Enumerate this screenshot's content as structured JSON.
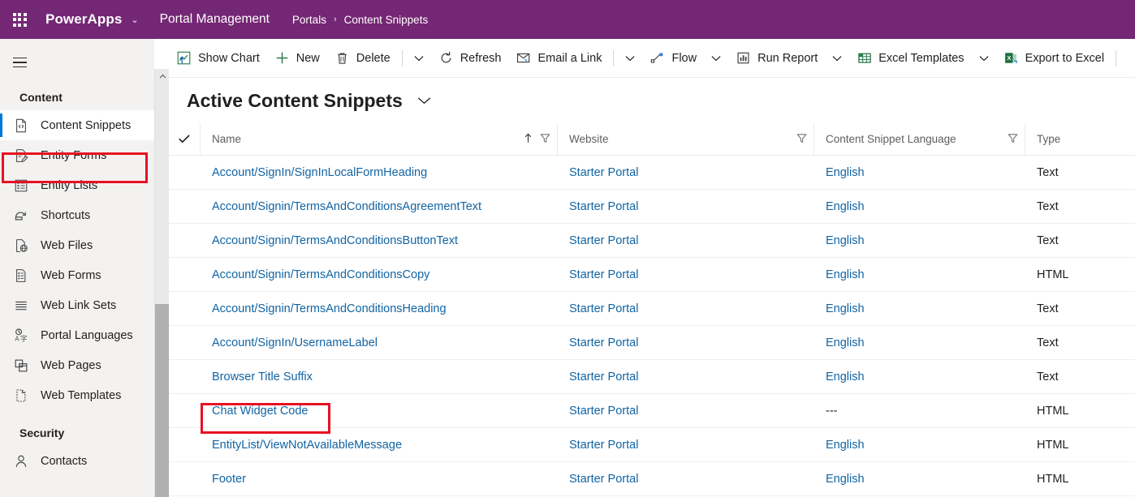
{
  "topbar": {
    "waffle_icon": "app-launcher-icon",
    "brand": "PowerApps",
    "brand_caret": "⌄",
    "app_name": "Portal Management",
    "breadcrumb": {
      "root": "Portals",
      "separator": "›",
      "current": "Content Snippets"
    },
    "background_color": "#742774"
  },
  "commandbar": {
    "items": [
      {
        "label": "Show Chart",
        "icon": "show-chart-icon",
        "caret": false
      },
      {
        "label": "New",
        "icon": "plus-icon",
        "caret": false
      },
      {
        "label": "Delete",
        "icon": "trash-icon",
        "caret": false
      },
      {
        "label": "",
        "icon": "overflow-caret-icon",
        "caret": true
      },
      {
        "label": "Refresh",
        "icon": "refresh-icon",
        "caret": false
      },
      {
        "label": "Email a Link",
        "icon": "email-link-icon",
        "caret": false
      },
      {
        "label": "",
        "icon": "overflow-caret-icon",
        "caret": true
      },
      {
        "label": "Flow",
        "icon": "flow-icon",
        "caret": true
      },
      {
        "label": "Run Report",
        "icon": "run-report-icon",
        "caret": true
      },
      {
        "label": "Excel Templates",
        "icon": "excel-templates-icon",
        "caret": true
      },
      {
        "label": "Export to Excel",
        "icon": "export-excel-icon",
        "caret": false
      }
    ]
  },
  "sidebar": {
    "hamburger_icon": "hamburger-menu-icon",
    "groups": [
      {
        "title": "Content",
        "items": [
          {
            "label": "Content Snippets",
            "icon": "code-file-icon",
            "selected": true
          },
          {
            "label": "Entity Forms",
            "icon": "form-edit-icon",
            "selected": false
          },
          {
            "label": "Entity Lists",
            "icon": "list-icon",
            "selected": false
          },
          {
            "label": "Shortcuts",
            "icon": "shortcut-icon",
            "selected": false
          },
          {
            "label": "Web Files",
            "icon": "web-file-icon",
            "selected": false
          },
          {
            "label": "Web Forms",
            "icon": "web-form-icon",
            "selected": false
          },
          {
            "label": "Web Link Sets",
            "icon": "link-sets-icon",
            "selected": false
          },
          {
            "label": "Portal Languages",
            "icon": "language-icon",
            "selected": false
          },
          {
            "label": "Web Pages",
            "icon": "web-pages-icon",
            "selected": false
          },
          {
            "label": "Web Templates",
            "icon": "web-template-icon",
            "selected": false
          }
        ]
      },
      {
        "title": "Security",
        "items": [
          {
            "label": "Contacts",
            "icon": "person-icon",
            "selected": false
          }
        ]
      }
    ],
    "scrollbar": {
      "up_arrow_icon": "chevron-up-icon"
    }
  },
  "view": {
    "title": "Active Content Snippets",
    "title_caret": "⌄"
  },
  "grid": {
    "select_all_icon": "checkmark-icon",
    "columns": [
      {
        "label": "Name",
        "sort": "ascending",
        "sort_icon": "arrow-up-icon",
        "filter_icon": "filter-icon"
      },
      {
        "label": "Website",
        "sort": "none",
        "filter_icon": "filter-icon"
      },
      {
        "label": "Content Snippet Language",
        "sort": "none",
        "filter_icon": "filter-icon"
      },
      {
        "label": "Type",
        "sort": "none",
        "filter_icon": ""
      }
    ],
    "rows": [
      {
        "name": "Account/SignIn/SignInLocalFormHeading",
        "website": "Starter Portal",
        "language": "English",
        "language_is_link": true,
        "type": "Text",
        "highlighted": false
      },
      {
        "name": "Account/Signin/TermsAndConditionsAgreementText",
        "website": "Starter Portal",
        "language": "English",
        "language_is_link": true,
        "type": "Text",
        "highlighted": false
      },
      {
        "name": "Account/Signin/TermsAndConditionsButtonText",
        "website": "Starter Portal",
        "language": "English",
        "language_is_link": true,
        "type": "Text",
        "highlighted": false
      },
      {
        "name": "Account/Signin/TermsAndConditionsCopy",
        "website": "Starter Portal",
        "language": "English",
        "language_is_link": true,
        "type": "HTML",
        "highlighted": false
      },
      {
        "name": "Account/Signin/TermsAndConditionsHeading",
        "website": "Starter Portal",
        "language": "English",
        "language_is_link": true,
        "type": "Text",
        "highlighted": false
      },
      {
        "name": "Account/SignIn/UsernameLabel",
        "website": "Starter Portal",
        "language": "English",
        "language_is_link": true,
        "type": "Text",
        "highlighted": false
      },
      {
        "name": "Browser Title Suffix",
        "website": "Starter Portal",
        "language": "English",
        "language_is_link": true,
        "type": "Text",
        "highlighted": false
      },
      {
        "name": "Chat Widget Code",
        "website": "Starter Portal",
        "language": "---",
        "language_is_link": false,
        "type": "HTML",
        "highlighted": true
      },
      {
        "name": "EntityList/ViewNotAvailableMessage",
        "website": "Starter Portal",
        "language": "English",
        "language_is_link": true,
        "type": "HTML",
        "highlighted": false
      },
      {
        "name": "Footer",
        "website": "Starter Portal",
        "language": "English",
        "language_is_link": true,
        "type": "HTML",
        "highlighted": false
      }
    ]
  },
  "annotations": {
    "highlight_color": "#e81123",
    "targets": [
      "sidebar-item-content-snippets",
      "row-cell-chat-widget-code"
    ]
  }
}
